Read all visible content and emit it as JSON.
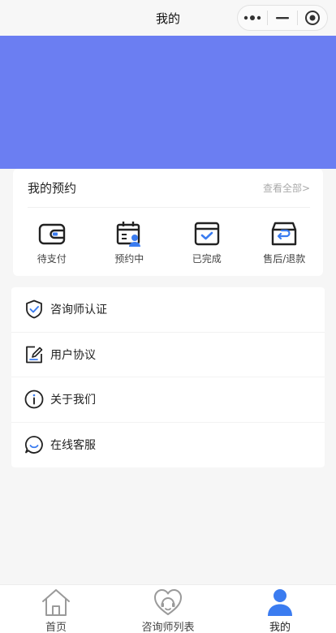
{
  "nav": {
    "title": "我的"
  },
  "appointments": {
    "title": "我的预约",
    "see_all": "查看全部>",
    "items": [
      {
        "label": "待支付",
        "icon": "wallet-icon"
      },
      {
        "label": "预约中",
        "icon": "calendar-user-icon"
      },
      {
        "label": "已完成",
        "icon": "calendar-check-icon"
      },
      {
        "label": "售后/退款",
        "icon": "return-box-icon"
      }
    ]
  },
  "menu": {
    "items": [
      {
        "label": "咨询师认证",
        "icon": "shield-check-icon"
      },
      {
        "label": "用户协议",
        "icon": "edit-document-icon"
      },
      {
        "label": "关于我们",
        "icon": "info-icon"
      },
      {
        "label": "在线客服",
        "icon": "chat-icon"
      }
    ]
  },
  "tabbar": {
    "items": [
      {
        "label": "首页",
        "icon": "home-icon"
      },
      {
        "label": "咨询师列表",
        "icon": "heart-headset-icon"
      },
      {
        "label": "我的",
        "icon": "user-icon",
        "active": true
      }
    ]
  },
  "colors": {
    "hero": "#6b7ef2",
    "accent": "#3b7cf0",
    "icon_stroke": "#222222"
  }
}
